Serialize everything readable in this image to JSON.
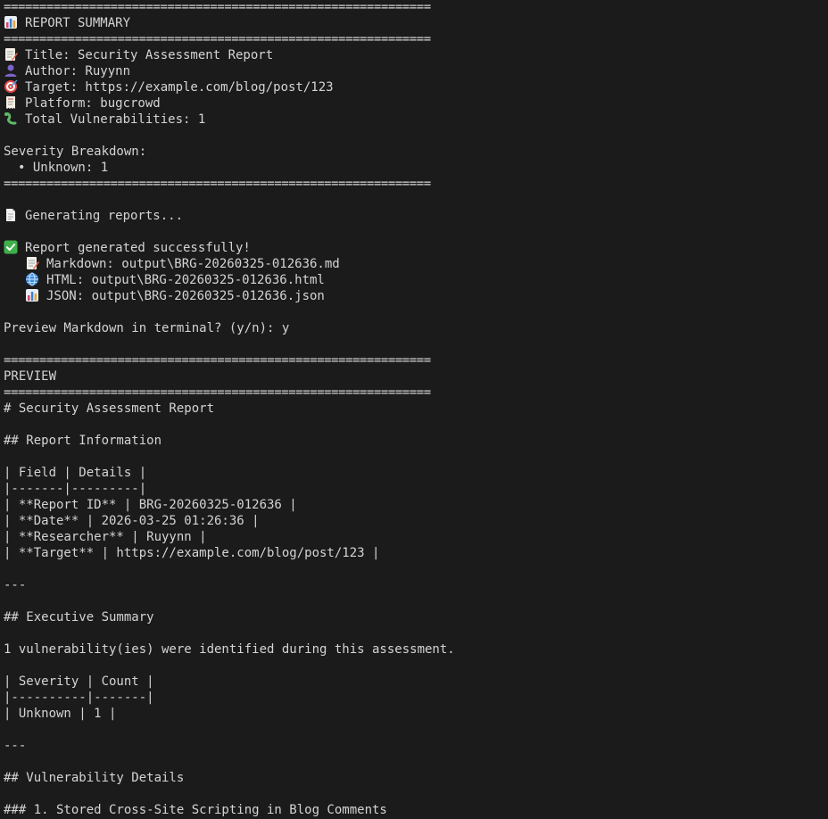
{
  "terminal": {
    "lines": [
      {
        "type": "rule",
        "text": "============================================================"
      },
      {
        "type": "icon",
        "icon": "bar-chart-icon",
        "text": "REPORT SUMMARY"
      },
      {
        "type": "rule",
        "text": "============================================================"
      },
      {
        "type": "icon",
        "icon": "memo-icon",
        "text": "Title: Security Assessment Report"
      },
      {
        "type": "icon",
        "icon": "user-icon",
        "text": "Author: Ruyynn"
      },
      {
        "type": "icon",
        "icon": "target-icon",
        "text": "Target: https://example.com/blog/post/123"
      },
      {
        "type": "icon",
        "icon": "receipt-icon",
        "text": "Platform: bugcrowd"
      },
      {
        "type": "icon",
        "icon": "worm-icon",
        "text": "Total Vulnerabilities: 1"
      },
      {
        "type": "blank",
        "text": ""
      },
      {
        "type": "text",
        "text": "Severity Breakdown:"
      },
      {
        "type": "bullet",
        "text": "• Unknown: 1"
      },
      {
        "type": "rule",
        "text": "============================================================"
      },
      {
        "type": "blank",
        "text": ""
      },
      {
        "type": "icon",
        "icon": "document-icon",
        "text": "Generating reports..."
      },
      {
        "type": "blank",
        "text": ""
      },
      {
        "type": "icon",
        "icon": "check-icon",
        "text": "Report generated successfully!"
      },
      {
        "type": "subicon",
        "icon": "memo-icon",
        "text": "Markdown: output\\BRG-20260325-012636.md"
      },
      {
        "type": "subicon",
        "icon": "globe-icon",
        "text": "HTML: output\\BRG-20260325-012636.html"
      },
      {
        "type": "subicon",
        "icon": "bar-chart-icon",
        "text": "JSON: output\\BRG-20260325-012636.json"
      },
      {
        "type": "blank",
        "text": ""
      },
      {
        "type": "text",
        "text": "Preview Markdown in terminal? (y/n): y"
      },
      {
        "type": "blank",
        "text": ""
      },
      {
        "type": "rule",
        "text": "============================================================"
      },
      {
        "type": "text",
        "text": "PREVIEW"
      },
      {
        "type": "rule",
        "text": "============================================================"
      },
      {
        "type": "text",
        "text": "# Security Assessment Report"
      },
      {
        "type": "blank",
        "text": ""
      },
      {
        "type": "text",
        "text": "## Report Information"
      },
      {
        "type": "blank",
        "text": ""
      },
      {
        "type": "text",
        "text": "| Field | Details |"
      },
      {
        "type": "text",
        "text": "|-------|---------|"
      },
      {
        "type": "text",
        "text": "| **Report ID** | BRG-20260325-012636 |"
      },
      {
        "type": "text",
        "text": "| **Date** | 2026-03-25 01:26:36 |"
      },
      {
        "type": "text",
        "text": "| **Researcher** | Ruyynn |"
      },
      {
        "type": "text",
        "text": "| **Target** | https://example.com/blog/post/123 |"
      },
      {
        "type": "blank",
        "text": ""
      },
      {
        "type": "text",
        "text": "---"
      },
      {
        "type": "blank",
        "text": ""
      },
      {
        "type": "text",
        "text": "## Executive Summary"
      },
      {
        "type": "blank",
        "text": ""
      },
      {
        "type": "text",
        "text": "1 vulnerability(ies) were identified during this assessment."
      },
      {
        "type": "blank",
        "text": ""
      },
      {
        "type": "text",
        "text": "| Severity | Count |"
      },
      {
        "type": "text",
        "text": "|----------|-------|"
      },
      {
        "type": "text",
        "text": "| Unknown | 1 |"
      },
      {
        "type": "blank",
        "text": ""
      },
      {
        "type": "text",
        "text": "---"
      },
      {
        "type": "blank",
        "text": ""
      },
      {
        "type": "text",
        "text": "## Vulnerability Details"
      },
      {
        "type": "blank",
        "text": ""
      },
      {
        "type": "text",
        "text": "### 1. Stored Cross-Site Scripting in Blog Comments"
      }
    ]
  }
}
